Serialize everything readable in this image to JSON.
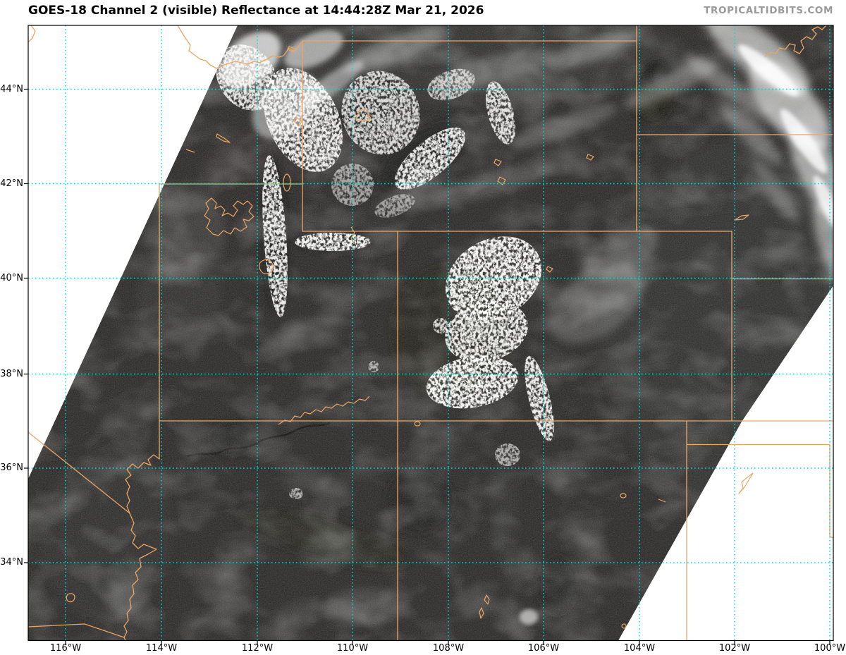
{
  "header": {
    "title": "GOES-18 Channel 2 (visible) Reflectance at 14:44:28Z Mar 21, 2026",
    "watermark": "TROPICALTIDBITS.COM"
  },
  "axes": {
    "lat_labels": [
      "44°N",
      "42°N",
      "40°N",
      "38°N",
      "36°N",
      "34°N"
    ],
    "lon_labels": [
      "116°W",
      "114°W",
      "112°W",
      "110°W",
      "108°W",
      "106°W",
      "104°W",
      "102°W",
      "100°W"
    ]
  },
  "map": {
    "layers": [
      "visible-satellite-imagery",
      "state-borders",
      "lakes-rivers",
      "lat-lon-grid"
    ],
    "no_data_regions": [
      "upper-left-triangle",
      "lower-right-triangle"
    ]
  },
  "colors": {
    "land": "#2b2a29",
    "grid": "#00d9d9",
    "border": "#eca660",
    "watermark": "#9a9a9a",
    "nodata": "#ffffff",
    "title": "#000000"
  }
}
